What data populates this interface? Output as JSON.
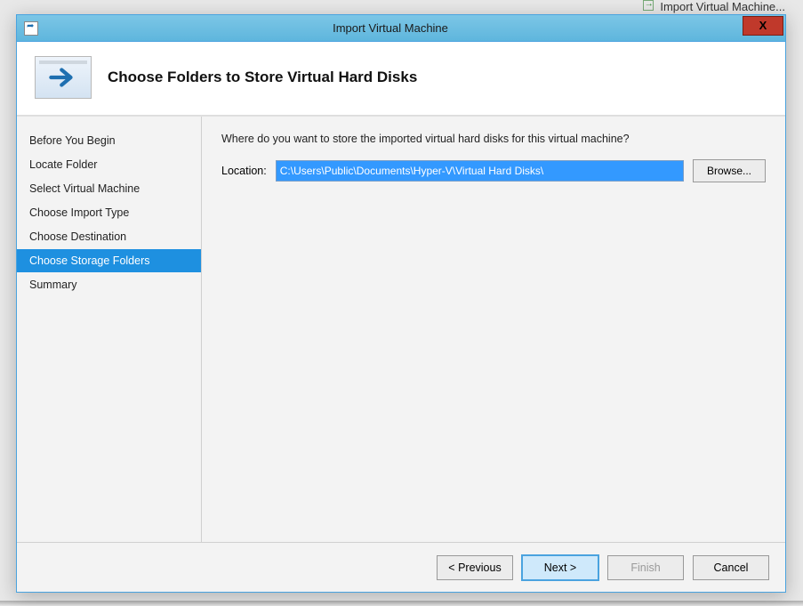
{
  "background": {
    "action_hint": "Import Virtual Machine..."
  },
  "titlebar": {
    "title": "Import Virtual Machine",
    "close_label": "X"
  },
  "header": {
    "title": "Choose Folders to Store Virtual Hard Disks"
  },
  "sidebar": {
    "items": [
      {
        "label": "Before You Begin",
        "selected": false
      },
      {
        "label": "Locate Folder",
        "selected": false
      },
      {
        "label": "Select Virtual Machine",
        "selected": false
      },
      {
        "label": "Choose Import Type",
        "selected": false
      },
      {
        "label": "Choose Destination",
        "selected": false
      },
      {
        "label": "Choose Storage Folders",
        "selected": true
      },
      {
        "label": "Summary",
        "selected": false
      }
    ]
  },
  "content": {
    "prompt": "Where do you want to store the imported virtual hard disks for this virtual machine?",
    "location_label": "Location:",
    "location_value": "C:\\Users\\Public\\Documents\\Hyper-V\\Virtual Hard Disks\\",
    "browse_label": "Browse..."
  },
  "footer": {
    "previous": "< Previous",
    "next": "Next >",
    "finish": "Finish",
    "cancel": "Cancel"
  }
}
